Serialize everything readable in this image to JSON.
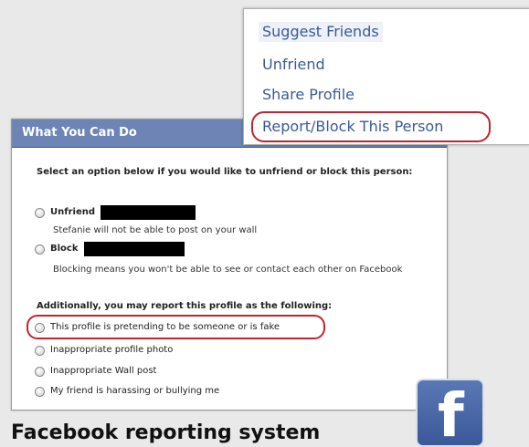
{
  "menu": {
    "items": [
      {
        "label": "Suggest Friends"
      },
      {
        "label": "Unfriend"
      },
      {
        "label": "Share Profile"
      },
      {
        "label": "Report/Block This Person"
      }
    ]
  },
  "dialog": {
    "title": "What You Can Do",
    "prompt": "Select an option below if you would like to unfriend or block this person:",
    "options": [
      {
        "label": "Unfriend",
        "description": "Stefanie will not be able to post on your wall"
      },
      {
        "label": "Block",
        "description": "Blocking means you won't be able to see or contact each other on Facebook"
      }
    ],
    "additional_heading": "Additionally, you may report this profile as the following:",
    "report_options": [
      {
        "label": "This profile is pretending to be someone or is fake"
      },
      {
        "label": "Inappropriate profile photo"
      },
      {
        "label": "Inappropriate Wall post"
      },
      {
        "label": "My friend is harassing or bullying me"
      }
    ]
  },
  "caption": "Facebook reporting system",
  "logo": {
    "letter": "f",
    "icon": "facebook-logo-icon"
  },
  "colors": {
    "accent": "#3b5998",
    "header": "#6d84b4",
    "highlight": "#c0252f"
  }
}
